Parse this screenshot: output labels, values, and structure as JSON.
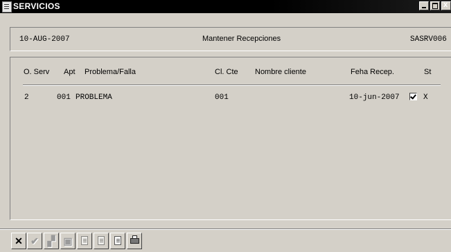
{
  "window": {
    "title": "SERVICIOS",
    "icon": "document-icon"
  },
  "header": {
    "date": "10-AUG-2007",
    "screen_title": "Mantener Recepciones",
    "code": "SASRV006"
  },
  "grid": {
    "columns": [
      "O. Serv",
      "Apt",
      "Problema/Falla",
      "Cl. Cte",
      "Nombre cliente",
      "Feha Recep.",
      "St"
    ],
    "rows": [
      {
        "o_serv": "2",
        "apt": "001",
        "problema": "PROBLEMA",
        "cl_cte": "001",
        "nombre": "",
        "fecha": "10-jun-2007",
        "checked": true,
        "st": "X"
      }
    ]
  },
  "toolbar": {
    "buttons": [
      {
        "name": "cancel",
        "icon": "x-icon",
        "glyph": "✕",
        "enabled": true
      },
      {
        "name": "accept",
        "icon": "check-icon",
        "glyph": "✔",
        "enabled": false
      },
      {
        "name": "copy",
        "icon": "copy-icon",
        "glyph": "▞",
        "enabled": false
      },
      {
        "name": "delete",
        "icon": "delete-icon",
        "glyph": "▣",
        "enabled": false
      },
      {
        "name": "previous",
        "icon": "document-prev-icon",
        "enabled": false
      },
      {
        "name": "next",
        "icon": "document-next-icon",
        "enabled": false
      },
      {
        "name": "new",
        "icon": "document-icon",
        "enabled": true
      },
      {
        "name": "print",
        "icon": "printer-icon",
        "enabled": true
      }
    ]
  }
}
